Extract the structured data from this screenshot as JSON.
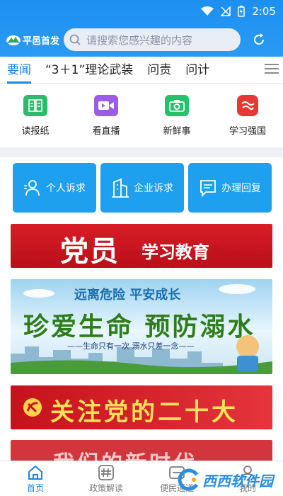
{
  "status_bar": {
    "time": "2:05"
  },
  "header": {
    "logo_text": "平邑首发",
    "search_placeholder": "请搜索您感兴趣的内容"
  },
  "tabs": [
    {
      "label": "要闻",
      "active": true
    },
    {
      "label": "“3＋1”理论武装",
      "active": false
    },
    {
      "label": "问责",
      "active": false
    },
    {
      "label": "问计",
      "active": false
    }
  ],
  "shortcuts": [
    {
      "label": "读报纸",
      "icon": "newspaper-icon",
      "color": "#2dbb6b"
    },
    {
      "label": "看直播",
      "icon": "video-icon",
      "color": "#9b5de5"
    },
    {
      "label": "新鲜事",
      "icon": "camera-icon",
      "color": "#24c36b"
    },
    {
      "label": "学习强国",
      "icon": "xuexi-icon",
      "color": "#e53935"
    }
  ],
  "actions": [
    {
      "label": "个人诉求",
      "icon": "person-icon"
    },
    {
      "label": "企业诉求",
      "icon": "building-icon"
    },
    {
      "label": "办理回复",
      "icon": "message-icon"
    }
  ],
  "banners": {
    "party_study": {
      "big": "党员",
      "small": "学习教育"
    },
    "drowning": {
      "top": "远离危险  平安成长",
      "main": "珍爱生命 预防溺水",
      "sub": "——生命只有一次  溺水只差一念——"
    },
    "congress": {
      "text": "关注党的二十大"
    },
    "new_era": {
      "text": "我们的新时代"
    }
  },
  "bottom_nav": [
    {
      "label": "首页",
      "icon": "home-icon",
      "active": true
    },
    {
      "label": "政策解读",
      "icon": "hash-icon",
      "active": false
    },
    {
      "label": "便民通道",
      "icon": "channel-icon",
      "active": false
    },
    {
      "label": "我的",
      "icon": "user-icon",
      "active": false
    }
  ],
  "watermark": {
    "text": "西西软件园"
  },
  "colors": {
    "primary": "#1a86e8",
    "header": "#1d8ff0",
    "action": "#1fa0ef"
  }
}
